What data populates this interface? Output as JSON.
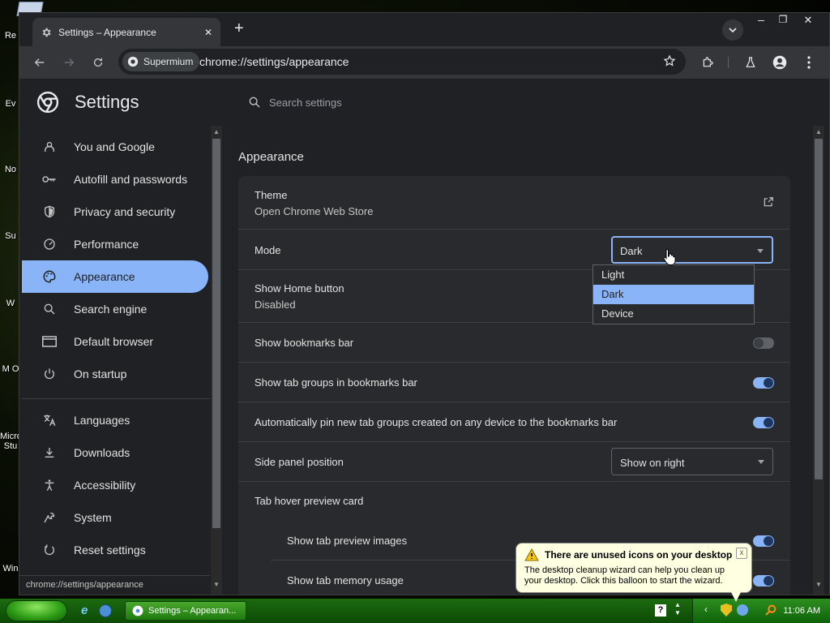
{
  "desktop": {
    "icons": [
      "Re",
      "Ev",
      "No",
      "Su",
      "W",
      "M O",
      "Micro Stu",
      "Win"
    ]
  },
  "window": {
    "tab_title": "Settings – Appearance",
    "new_tab": "+",
    "controls": {
      "minimize": "–",
      "maximize": "❐",
      "close": "✕"
    },
    "omnibox": {
      "chip": "Supermium",
      "url": "chrome://settings/appearance"
    }
  },
  "settings": {
    "title": "Settings",
    "search_placeholder": "Search settings",
    "nav": [
      {
        "label": "You and Google",
        "icon": "person-icon"
      },
      {
        "label": "Autofill and passwords",
        "icon": "key-icon"
      },
      {
        "label": "Privacy and security",
        "icon": "shield-icon"
      },
      {
        "label": "Performance",
        "icon": "speedometer-icon"
      },
      {
        "label": "Appearance",
        "icon": "palette-icon",
        "active": true
      },
      {
        "label": "Search engine",
        "icon": "search-icon"
      },
      {
        "label": "Default browser",
        "icon": "browser-icon"
      },
      {
        "label": "On startup",
        "icon": "power-icon"
      },
      {
        "label": "Languages",
        "icon": "translate-icon"
      },
      {
        "label": "Downloads",
        "icon": "download-icon"
      },
      {
        "label": "Accessibility",
        "icon": "accessibility-icon"
      },
      {
        "label": "System",
        "icon": "wrench-icon"
      },
      {
        "label": "Reset settings",
        "icon": "reset-icon"
      }
    ],
    "status_url": "chrome://settings/appearance",
    "section_title": "Appearance",
    "theme": {
      "label": "Theme",
      "sub": "Open Chrome Web Store"
    },
    "mode": {
      "label": "Mode",
      "value": "Dark",
      "options": [
        "Light",
        "Dark",
        "Device"
      ],
      "selected": "Dark"
    },
    "home_button": {
      "label": "Show Home button",
      "sub": "Disabled"
    },
    "bookmarks_bar": {
      "label": "Show bookmarks bar",
      "on": false
    },
    "tab_groups": {
      "label": "Show tab groups in bookmarks bar",
      "on": true
    },
    "autopin": {
      "label": "Automatically pin new tab groups created on any device to the bookmarks bar",
      "on": true
    },
    "side_panel": {
      "label": "Side panel position",
      "value": "Show on right"
    },
    "hover_card": {
      "label": "Tab hover preview card"
    },
    "preview_images": {
      "label": "Show tab preview images",
      "on": true
    },
    "memory_usage": {
      "label": "Show tab memory usage",
      "on": true
    }
  },
  "taskbar": {
    "task_title": "Settings – Appearan...",
    "clock": "11:06 AM"
  },
  "balloon": {
    "title": "There are unused icons on your desktop",
    "body": "The desktop cleanup wizard can help you clean up your desktop. Click this balloon to start the wizard.",
    "close": "x"
  },
  "colors": {
    "accent": "#8ab4f8",
    "surface": "#292a2d",
    "bg": "#202124"
  }
}
